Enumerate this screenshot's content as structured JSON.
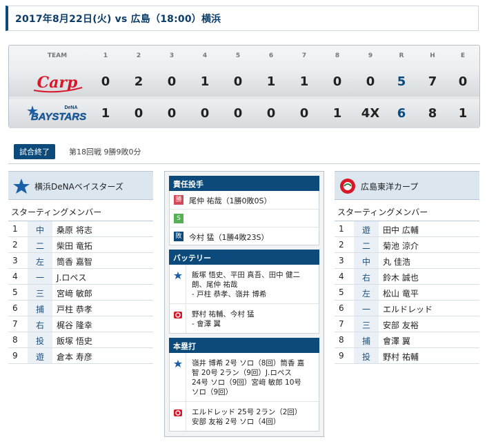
{
  "header": {
    "title": "2017年8月22日(火)  vs 広島（18:00）横浜"
  },
  "scoreboard": {
    "team_header": "TEAM",
    "columns": [
      "1",
      "2",
      "3",
      "4",
      "5",
      "6",
      "7",
      "8",
      "9",
      "R",
      "H",
      "E"
    ],
    "teams": [
      {
        "logo_text": "Carp",
        "scores": [
          "0",
          "2",
          "0",
          "1",
          "0",
          "1",
          "1",
          "0",
          "0",
          "5",
          "7",
          "0"
        ]
      },
      {
        "logo_text": "BAYSTARS",
        "logo_sub": "DeNA",
        "scores": [
          "1",
          "0",
          "0",
          "0",
          "0",
          "0",
          "0",
          "1",
          "4X",
          "6",
          "8",
          "1"
        ]
      }
    ]
  },
  "status": {
    "badge": "試合終了",
    "info": "第18回戦 9勝9敗0分"
  },
  "home": {
    "name": "横浜DeNAベイスターズ",
    "starting_label": "スターティングメンバー",
    "lineup": [
      {
        "num": "1",
        "pos": "中",
        "name": "桑原 将志"
      },
      {
        "num": "2",
        "pos": "二",
        "name": "柴田 竜拓"
      },
      {
        "num": "3",
        "pos": "左",
        "name": "筒香 嘉智"
      },
      {
        "num": "4",
        "pos": "一",
        "name": "J.ロペス"
      },
      {
        "num": "5",
        "pos": "三",
        "name": "宮﨑 敏郎"
      },
      {
        "num": "6",
        "pos": "捕",
        "name": "戸柱 恭孝"
      },
      {
        "num": "7",
        "pos": "右",
        "name": "梶谷 隆幸"
      },
      {
        "num": "8",
        "pos": "投",
        "name": "飯塚 悟史"
      },
      {
        "num": "9",
        "pos": "遊",
        "name": "倉本 寿彦"
      }
    ]
  },
  "visitor": {
    "name": "広島東洋カープ",
    "starting_label": "スターティングメンバー",
    "lineup": [
      {
        "num": "1",
        "pos": "遊",
        "name": "田中 広輔"
      },
      {
        "num": "2",
        "pos": "二",
        "name": "菊池 涼介"
      },
      {
        "num": "3",
        "pos": "中",
        "name": "丸 佳浩"
      },
      {
        "num": "4",
        "pos": "右",
        "name": "鈴木 誠也"
      },
      {
        "num": "5",
        "pos": "左",
        "name": "松山 竜平"
      },
      {
        "num": "6",
        "pos": "一",
        "name": "エルドレッド"
      },
      {
        "num": "7",
        "pos": "三",
        "name": "安部 友裕"
      },
      {
        "num": "8",
        "pos": "捕",
        "name": "會澤 翼"
      },
      {
        "num": "9",
        "pos": "投",
        "name": "野村 祐輔"
      }
    ]
  },
  "pitchers": {
    "heading": "責任投手",
    "win_tag": "勝",
    "win": "尾仲 祐哉（1勝0敗0S）",
    "save_tag": "S",
    "save": "",
    "loss_tag": "敗",
    "loss": "今村 猛（1勝4敗23S）"
  },
  "battery": {
    "heading": "バッテリー",
    "home_line1": "飯塚 悟史、平田 真吾、田中 健二",
    "home_line2": "朗、尾仲 祐哉",
    "home_line3": "- 戸柱 恭孝、嶺井 博希",
    "visitor_line1": "野村 祐輔、今村 猛",
    "visitor_line2": "- 會澤 翼"
  },
  "homeruns": {
    "heading": "本塁打",
    "home_line1": "嶺井 博希 2号 ソロ（8回）筒香 嘉",
    "home_line2": "智 20号 2ラン（9回）J.ロペス",
    "home_line3": "24号 ソロ（9回）宮﨑 敏郎 10号",
    "home_line4": "ソロ（9回）",
    "visitor_line1": "エルドレッド 25号 2ラン（2回）",
    "visitor_line2": "安部 友裕 2号 ソロ（4回）"
  },
  "colors": {
    "accent": "#0b4a7a",
    "carp_red": "#d7182a",
    "win": "#d24a5a",
    "save": "#56b055"
  }
}
